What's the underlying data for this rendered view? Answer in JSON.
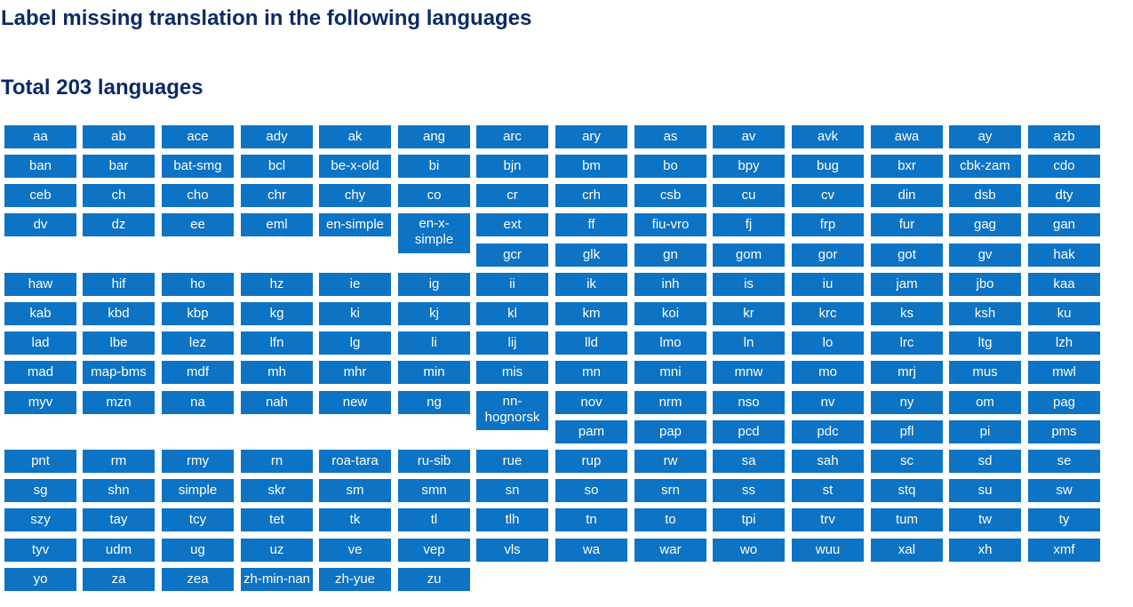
{
  "page": {
    "title": "Label missing translation in the following languages",
    "total": "Total 203 languages"
  },
  "languages": [
    "aa",
    "ab",
    "ace",
    "ady",
    "ak",
    "ang",
    "arc",
    "ary",
    "as",
    "av",
    "avk",
    "awa",
    "ay",
    "azb",
    "ban",
    "bar",
    "bat-smg",
    "bcl",
    "be-x-old",
    "bi",
    "bjn",
    "bm",
    "bo",
    "bpy",
    "bug",
    "bxr",
    "cbk-zam",
    "cdo",
    "ceb",
    "ch",
    "cho",
    "chr",
    "chy",
    "co",
    "cr",
    "crh",
    "csb",
    "cu",
    "cv",
    "din",
    "dsb",
    "dty",
    "dv",
    "dz",
    "ee",
    "eml",
    "en-simple",
    "en-x-simple",
    "ext",
    "ff",
    "fiu-vro",
    "fj",
    "frp",
    "fur",
    "gag",
    "gan",
    "gcr",
    "glk",
    "gn",
    "gom",
    "gor",
    "got",
    "gv",
    "hak",
    "haw",
    "hif",
    "ho",
    "hz",
    "ie",
    "ig",
    "ii",
    "ik",
    "inh",
    "is",
    "iu",
    "jam",
    "jbo",
    "kaa",
    "kab",
    "kbd",
    "kbp",
    "kg",
    "ki",
    "kj",
    "kl",
    "km",
    "koi",
    "kr",
    "krc",
    "ks",
    "ksh",
    "ku",
    "lad",
    "lbe",
    "lez",
    "lfn",
    "lg",
    "li",
    "lij",
    "lld",
    "lmo",
    "ln",
    "lo",
    "lrc",
    "ltg",
    "lzh",
    "mad",
    "map-bms",
    "mdf",
    "mh",
    "mhr",
    "min",
    "mis",
    "mn",
    "mni",
    "mnw",
    "mo",
    "mrj",
    "mus",
    "mwl",
    "myv",
    "mzn",
    "na",
    "nah",
    "new",
    "ng",
    "nn-hognorsk",
    "nov",
    "nrm",
    "nso",
    "nv",
    "ny",
    "om",
    "pag",
    "pam",
    "pap",
    "pcd",
    "pdc",
    "pfl",
    "pi",
    "pms",
    "pnt",
    "rm",
    "rmy",
    "rn",
    "roa-tara",
    "ru-sib",
    "rue",
    "rup",
    "rw",
    "sa",
    "sah",
    "sc",
    "sd",
    "se",
    "sg",
    "shn",
    "simple",
    "skr",
    "sm",
    "smn",
    "sn",
    "so",
    "srn",
    "ss",
    "st",
    "stq",
    "su",
    "sw",
    "szy",
    "tay",
    "tcy",
    "tet",
    "tk",
    "tl",
    "tlh",
    "tn",
    "to",
    "tpi",
    "trv",
    "tum",
    "tw",
    "ty",
    "tyv",
    "udm",
    "ug",
    "uz",
    "ve",
    "vep",
    "vls",
    "wa",
    "war",
    "wo",
    "wuu",
    "xal",
    "xh",
    "xmf",
    "yo",
    "za",
    "zea",
    "zh-min-nan",
    "zh-yue",
    "zu"
  ]
}
